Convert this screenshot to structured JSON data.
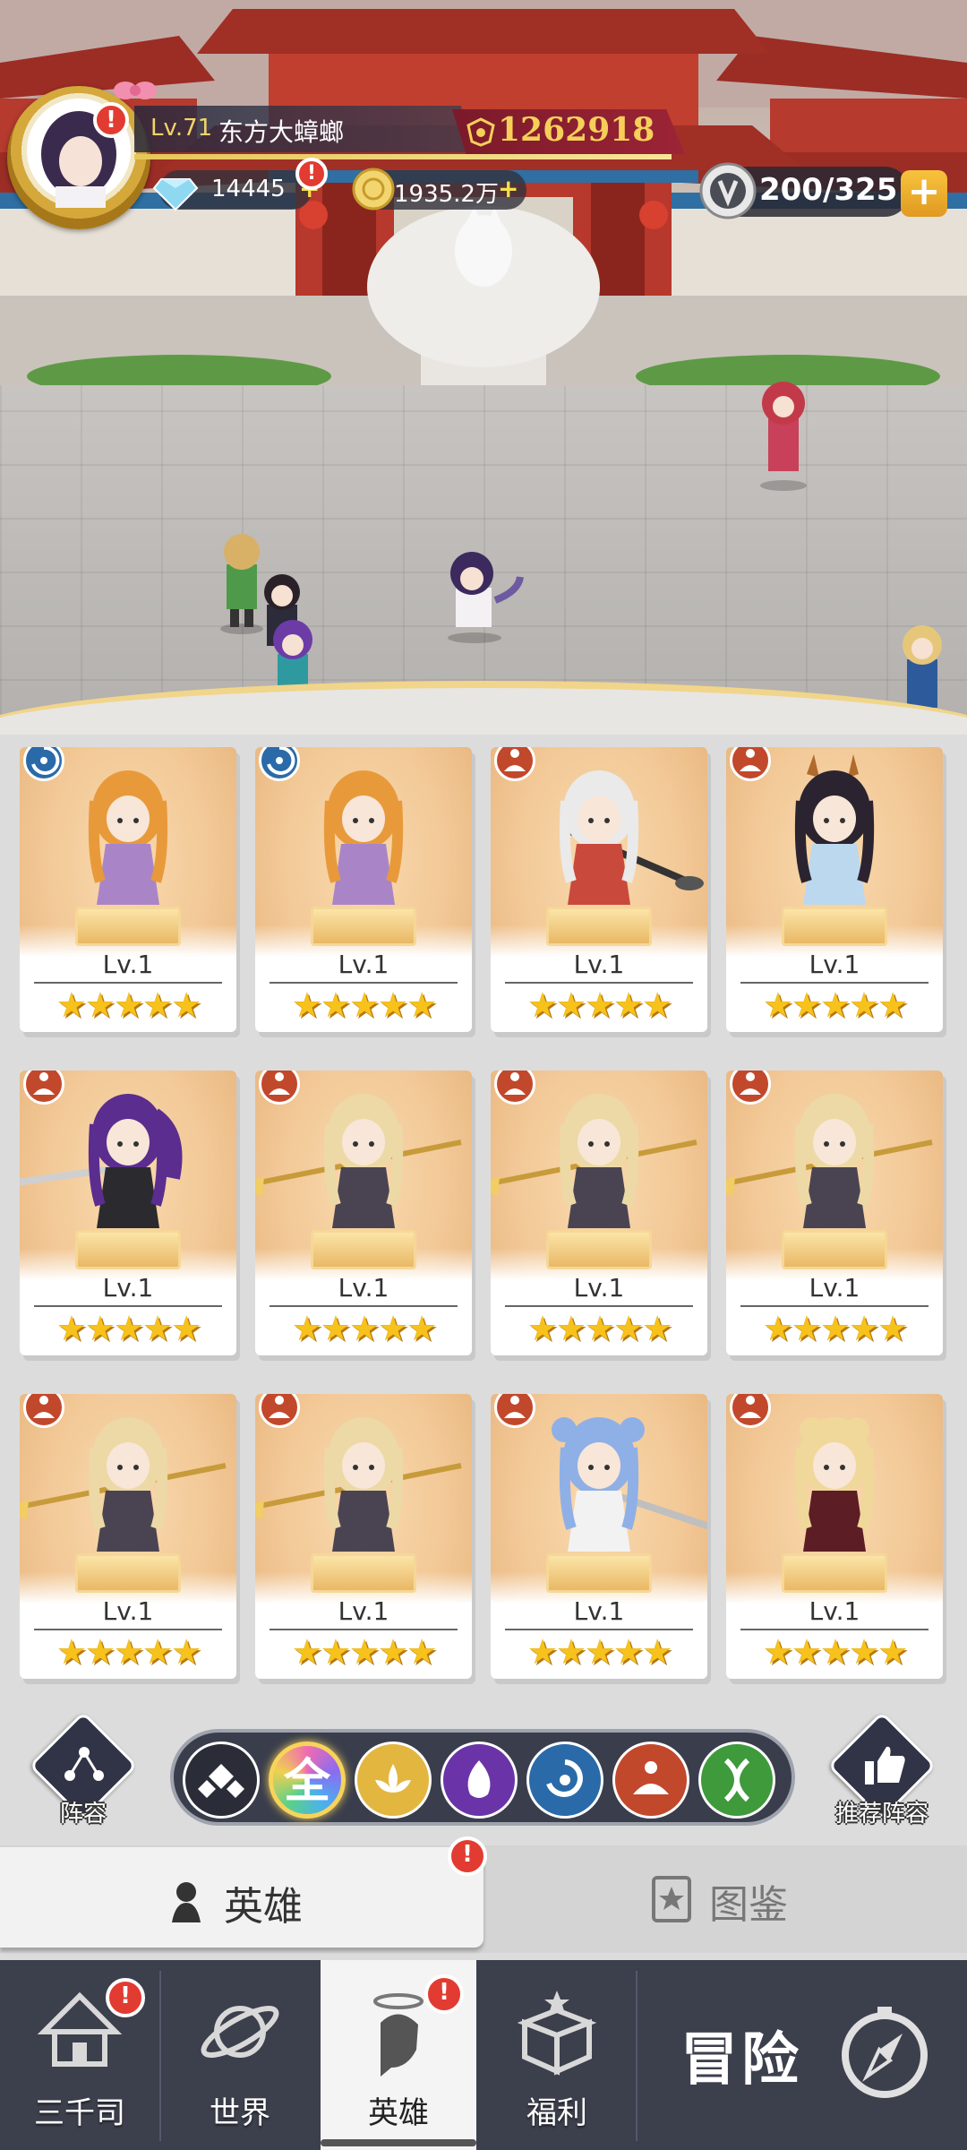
{
  "player": {
    "level_label": "Lv.71",
    "name": "东方大蟑螂",
    "power": "1262918",
    "diamonds": "14445",
    "gold": "1935.2万",
    "energy": "200/325"
  },
  "heroes": [
    {
      "level": "Lv.1",
      "stars": "★★★★★",
      "faction": "water",
      "char": "orange-hair-girl"
    },
    {
      "level": "Lv.1",
      "stars": "★★★★★",
      "faction": "water",
      "char": "orange-hair-girl"
    },
    {
      "level": "Lv.1",
      "stars": "★★★★★",
      "faction": "mind",
      "char": "white-hair-brush-girl"
    },
    {
      "level": "Lv.1",
      "stars": "★★★★★",
      "faction": "mind",
      "char": "horned-dark-hair-girl"
    },
    {
      "level": "Lv.1",
      "stars": "★★★★★",
      "faction": "mind",
      "char": "purple-ponytail-swordswoman"
    },
    {
      "level": "Lv.1",
      "stars": "★★★★★",
      "faction": "mind",
      "char": "blonde-spear-girl"
    },
    {
      "level": "Lv.1",
      "stars": "★★★★★",
      "faction": "mind",
      "char": "blonde-spear-girl"
    },
    {
      "level": "Lv.1",
      "stars": "★★★★★",
      "faction": "mind",
      "char": "blonde-spear-girl"
    },
    {
      "level": "Lv.1",
      "stars": "★★★★★",
      "faction": "mind",
      "char": "blonde-spear-girl"
    },
    {
      "level": "Lv.1",
      "stars": "★★★★★",
      "faction": "mind",
      "char": "blonde-spear-girl"
    },
    {
      "level": "Lv.1",
      "stars": "★★★★★",
      "faction": "mind",
      "char": "blue-hair-sword-girl"
    },
    {
      "level": "Lv.1",
      "stars": "★★★★★",
      "faction": "mind",
      "char": "blonde-bun-girl"
    }
  ],
  "controls": {
    "lineup_label": "阵容",
    "recommend_label": "推荐阵容",
    "filters": [
      {
        "icon": "diamond-tiles-icon",
        "label": "",
        "color": "#2a2d38"
      },
      {
        "icon": "all-filter-icon",
        "label": "全",
        "color": "#d46ab0"
      },
      {
        "icon": "lotus-icon",
        "label": "",
        "color": "#e3b640"
      },
      {
        "icon": "flame-icon",
        "label": "",
        "color": "#6a34a8"
      },
      {
        "icon": "swirl-icon",
        "label": "",
        "color": "#2a6aa8"
      },
      {
        "icon": "meditation-icon",
        "label": "",
        "color": "#c2482c"
      },
      {
        "icon": "dna-icon",
        "label": "",
        "color": "#3e9a3a"
      }
    ]
  },
  "tabs": {
    "heroes": "英雄",
    "codex": "图鉴"
  },
  "nav": {
    "items": [
      "三千司",
      "世界",
      "英雄",
      "福利"
    ],
    "adventure": "冒险"
  },
  "colors": {
    "alert": "#e23b31",
    "power": "#f6cf5a",
    "star": "#f7c21c"
  }
}
